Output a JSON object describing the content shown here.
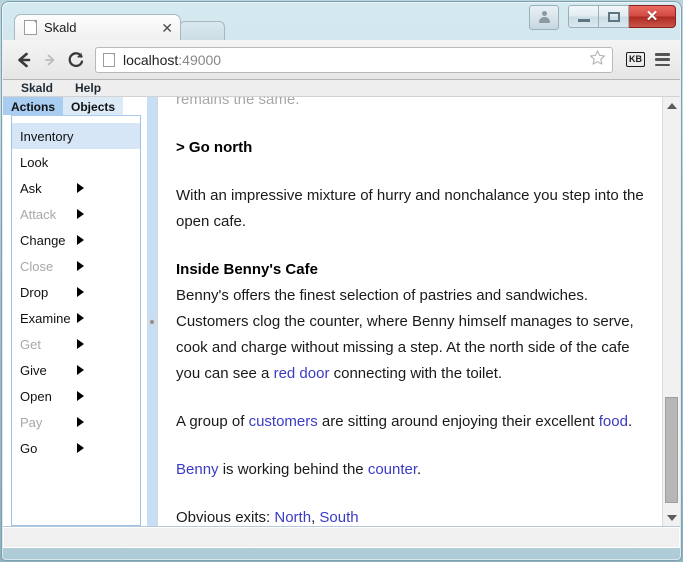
{
  "window": {
    "caption_buttons": [
      {
        "name": "user-account-button",
        "icon": "user-icon",
        "label": ""
      },
      {
        "name": "minimize-button",
        "icon": "minimize-icon",
        "label": ""
      },
      {
        "name": "maximize-button",
        "icon": "maximize-icon",
        "label": ""
      },
      {
        "name": "close-button",
        "icon": "close-icon",
        "label": "✕"
      }
    ]
  },
  "browser": {
    "tab": {
      "title": "Skald",
      "favicon": "page-icon",
      "close_label": "✕"
    },
    "toolbar": {
      "back_icon": "back-arrow-icon",
      "forward_icon": "forward-arrow-icon",
      "reload_icon": "reload-icon",
      "url_host": "localhost",
      "url_port": ":49000",
      "url_full": "localhost:49000",
      "star_icon": "star-icon",
      "extension_badge": "KB",
      "menu_icon": "hamburger-menu-icon"
    }
  },
  "app": {
    "menubar": [
      {
        "label": "Skald"
      },
      {
        "label": "Help"
      }
    ],
    "sidebar": {
      "tabs": [
        {
          "label": "Actions",
          "active": true
        },
        {
          "label": "Objects",
          "active": false
        }
      ],
      "items": [
        {
          "label": "Inventory",
          "submenu": false,
          "disabled": false,
          "highlight": true
        },
        {
          "label": "Look",
          "submenu": false,
          "disabled": false,
          "highlight": false
        },
        {
          "label": "Ask",
          "submenu": true,
          "disabled": false,
          "highlight": false
        },
        {
          "label": "Attack",
          "submenu": true,
          "disabled": true,
          "highlight": false
        },
        {
          "label": "Change",
          "submenu": true,
          "disabled": false,
          "highlight": false
        },
        {
          "label": "Close",
          "submenu": true,
          "disabled": true,
          "highlight": false
        },
        {
          "label": "Drop",
          "submenu": true,
          "disabled": false,
          "highlight": false
        },
        {
          "label": "Examine",
          "submenu": true,
          "disabled": false,
          "highlight": false
        },
        {
          "label": "Get",
          "submenu": true,
          "disabled": true,
          "highlight": false
        },
        {
          "label": "Give",
          "submenu": true,
          "disabled": false,
          "highlight": false
        },
        {
          "label": "Open",
          "submenu": true,
          "disabled": false,
          "highlight": false
        },
        {
          "label": "Pay",
          "submenu": true,
          "disabled": true,
          "highlight": false
        },
        {
          "label": "Go",
          "submenu": true,
          "disabled": false,
          "highlight": false
        }
      ]
    },
    "story": {
      "faded_tail": "remains the same.",
      "command": "> Go north",
      "paragraph_move": "With an impressive mixture of hurry and nonchalance you step into the open cafe.",
      "room_title": "Inside Benny's Cafe",
      "room_desc_1": "Benny's offers the finest selection of pastries and sandwiches.  Customers clog the counter, where Benny himself manages to serve, cook and charge without missing a step.  At the north side of the cafe you can see a ",
      "room_link_reddoor": "red door",
      "room_desc_2": " connecting with the toilet.",
      "group_1": "A group of ",
      "group_link_customers": "customers",
      "group_2": " are sitting around enjoying their excellent ",
      "group_link_food": "food",
      "group_3": ".",
      "benny_link": "Benny",
      "benny_mid": " is working behind the ",
      "benny_link_counter": "counter",
      "benny_end": ".",
      "exits_label": "Obvious exits: ",
      "exit_north": "North",
      "exits_sep": ", ",
      "exit_south": "South"
    },
    "scrollbar": {
      "up_icon": "scroll-up-arrow-icon",
      "down_icon": "scroll-down-arrow-icon"
    },
    "statusbar_text": ""
  },
  "colors": {
    "link": "#3b3bc4",
    "tab_active": "#a8cdf0",
    "tab_inactive": "#dceaf8",
    "highlight": "#d6e6f7",
    "splitter": "#c8def4",
    "faded_text": "#a7a7a7",
    "close_button": "#c8544a"
  }
}
